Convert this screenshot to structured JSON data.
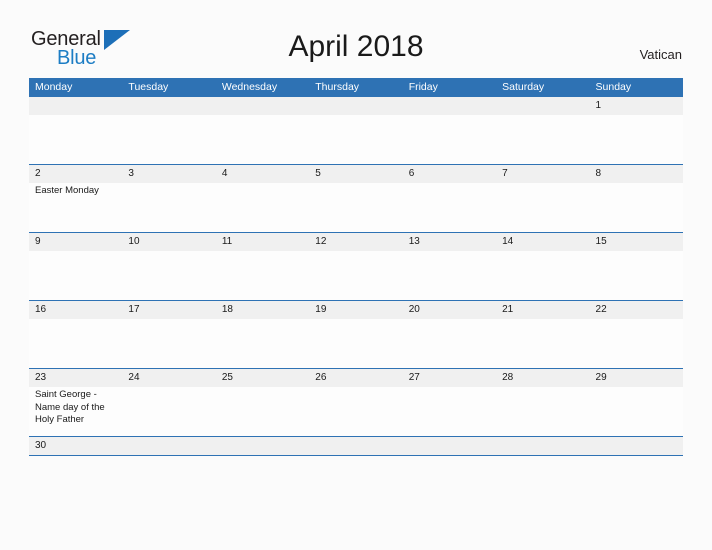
{
  "brand": {
    "name_top": "General",
    "name_bottom": "Blue",
    "flag_icon": "blue-flag-triangle",
    "accent_color": "#1d7dc4"
  },
  "header": {
    "title": "April 2018",
    "region": "Vatican"
  },
  "colors": {
    "header_blue": "#2e72b4",
    "band_gray": "#f0f0f0",
    "page_background": "#fbfbfb",
    "text": "#1a1a1a"
  },
  "calendar": {
    "month": "April",
    "year": "2018",
    "weekday_headers": [
      "Monday",
      "Tuesday",
      "Wednesday",
      "Thursday",
      "Friday",
      "Saturday",
      "Sunday"
    ],
    "weeks": [
      {
        "days": [
          {
            "num": "",
            "event": ""
          },
          {
            "num": "",
            "event": ""
          },
          {
            "num": "",
            "event": ""
          },
          {
            "num": "",
            "event": ""
          },
          {
            "num": "",
            "event": ""
          },
          {
            "num": "",
            "event": ""
          },
          {
            "num": "1",
            "event": ""
          }
        ]
      },
      {
        "days": [
          {
            "num": "2",
            "event": "Easter Monday"
          },
          {
            "num": "3",
            "event": ""
          },
          {
            "num": "4",
            "event": ""
          },
          {
            "num": "5",
            "event": ""
          },
          {
            "num": "6",
            "event": ""
          },
          {
            "num": "7",
            "event": ""
          },
          {
            "num": "8",
            "event": ""
          }
        ]
      },
      {
        "days": [
          {
            "num": "9",
            "event": ""
          },
          {
            "num": "10",
            "event": ""
          },
          {
            "num": "11",
            "event": ""
          },
          {
            "num": "12",
            "event": ""
          },
          {
            "num": "13",
            "event": ""
          },
          {
            "num": "14",
            "event": ""
          },
          {
            "num": "15",
            "event": ""
          }
        ]
      },
      {
        "days": [
          {
            "num": "16",
            "event": ""
          },
          {
            "num": "17",
            "event": ""
          },
          {
            "num": "18",
            "event": ""
          },
          {
            "num": "19",
            "event": ""
          },
          {
            "num": "20",
            "event": ""
          },
          {
            "num": "21",
            "event": ""
          },
          {
            "num": "22",
            "event": ""
          }
        ]
      },
      {
        "days": [
          {
            "num": "23",
            "event": "Saint George - Name day of the Holy Father"
          },
          {
            "num": "24",
            "event": ""
          },
          {
            "num": "25",
            "event": ""
          },
          {
            "num": "26",
            "event": ""
          },
          {
            "num": "27",
            "event": ""
          },
          {
            "num": "28",
            "event": ""
          },
          {
            "num": "29",
            "event": ""
          }
        ]
      },
      {
        "days": [
          {
            "num": "30",
            "event": ""
          },
          {
            "num": "",
            "event": ""
          },
          {
            "num": "",
            "event": ""
          },
          {
            "num": "",
            "event": ""
          },
          {
            "num": "",
            "event": ""
          },
          {
            "num": "",
            "event": ""
          },
          {
            "num": "",
            "event": ""
          }
        ]
      }
    ]
  }
}
